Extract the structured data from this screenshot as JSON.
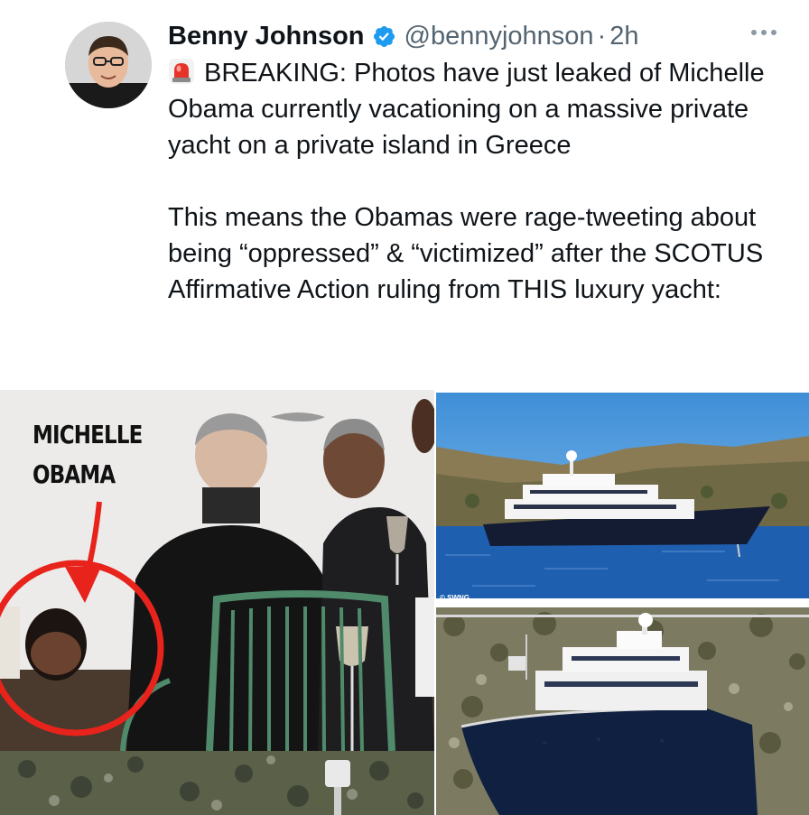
{
  "author": {
    "name": "Benny Johnson",
    "handle": "@bennyjohnson",
    "separator": "·",
    "time": "2h"
  },
  "icons": {
    "verified": "verified-badge-icon",
    "more": "more-options-icon",
    "siren": "police-light-emoji"
  },
  "tweet": {
    "paragraph1": "BREAKING: Photos have just leaked of Michelle Obama currently vacationing on a massive private yacht on a private island in Greece",
    "paragraph2": "This means the Obamas were rage-tweeting about being “oppressed” & “victimized” after the SCOTUS Affirmative Action ruling from THIS luxury yacht:"
  },
  "media": {
    "photo1_label_line1": "MICHELLE",
    "photo1_label_line2": "OBAMA",
    "photo2_watermark": "© SWNG"
  },
  "colors": {
    "verified_blue": "#1d9bf0",
    "secondary_text": "#536471",
    "annotation_red": "#e8231b"
  }
}
